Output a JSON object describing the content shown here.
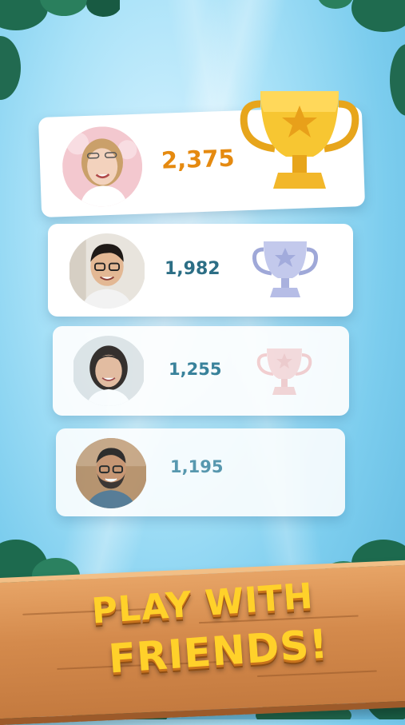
{
  "colors": {
    "sky": "#a9e2f8",
    "card": "#ffffff",
    "top_score": "#e58a10",
    "score": "#2c6e85",
    "title_fill": "#ffd12a",
    "title_outline": "#8e4e14",
    "plank": "#d48a4c"
  },
  "leaderboard": [
    {
      "rank": 1,
      "score": "2,375",
      "avatar": "woman-blonde-avatar",
      "trophy": "gold-trophy-icon"
    },
    {
      "rank": 2,
      "score": "1,982",
      "avatar": "man-glasses-avatar",
      "trophy": "silver-trophy-icon"
    },
    {
      "rank": 3,
      "score": "1,255",
      "avatar": "woman-dark-hair-avatar",
      "trophy": "bronze-trophy-icon"
    },
    {
      "rank": 4,
      "score": "1,195",
      "avatar": "man-beard-glasses-avatar",
      "trophy": ""
    }
  ],
  "banner": {
    "line1": "PLAY WITH",
    "line2": "FRIENDS!"
  }
}
